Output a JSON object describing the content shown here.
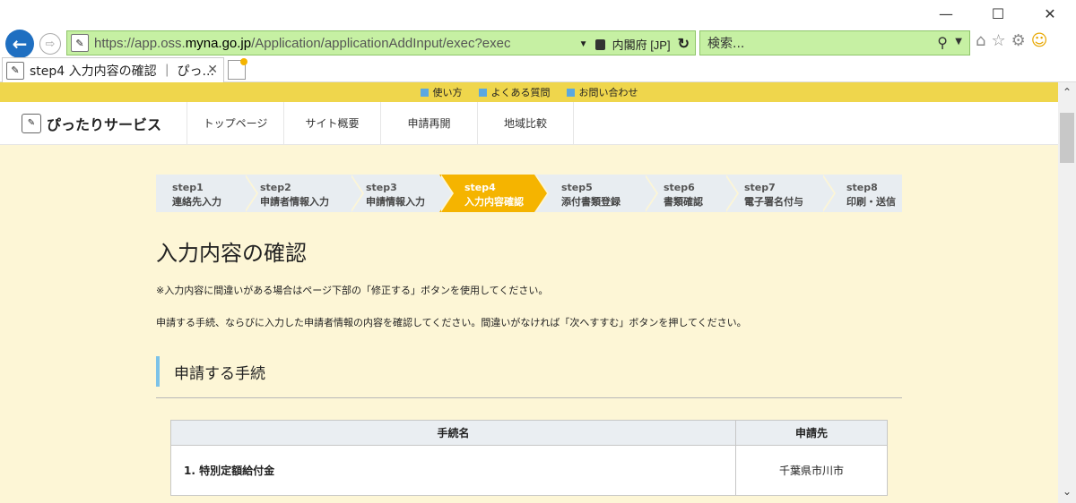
{
  "browser": {
    "url_prefix": "https://app.oss.",
    "url_domain": "myna.go.jp",
    "url_path": "/Application/applicationAddInput/exec?exec",
    "cert_owner": "内閣府 [JP]",
    "search_placeholder": "検索...",
    "tab_title": "step4 入力内容の確認 ｜ ぴっ...",
    "minimize": "—",
    "maximize": "☐",
    "close": "✕"
  },
  "topbar": {
    "links": [
      "使い方",
      "よくある質問",
      "お問い合わせ"
    ]
  },
  "header": {
    "logo": "ぴったりサービス",
    "nav": [
      "トップページ",
      "サイト概要",
      "申請再開",
      "地域比較"
    ]
  },
  "steps": [
    {
      "num": "step1",
      "label": "連絡先入力"
    },
    {
      "num": "step2",
      "label": "申請者情報入力"
    },
    {
      "num": "step3",
      "label": "申請情報入力"
    },
    {
      "num": "step4",
      "label": "入力内容確認"
    },
    {
      "num": "step5",
      "label": "添付書類登録"
    },
    {
      "num": "step6",
      "label": "書類確認"
    },
    {
      "num": "step7",
      "label": "電子署名付与"
    },
    {
      "num": "step8",
      "label": "印刷・送信"
    }
  ],
  "active_step": 4,
  "page": {
    "title": "入力内容の確認",
    "note": "※入力内容に間違いがある場合はページ下部の「修正する」ボタンを使用してください。",
    "desc": "申請する手続、ならびに入力した申請者情報の内容を確認してください。間違いがなければ「次へすすむ」ボタンを押してください。",
    "section_title": "申請する手続"
  },
  "table": {
    "headers": [
      "手続名",
      "申請先"
    ],
    "rows": [
      {
        "name": "1. 特別定額給付金",
        "dest": "千葉県市川市"
      }
    ]
  },
  "colors": {
    "accent_yellow": "#f5b400",
    "topbar": "#efd64c",
    "page_bg": "#fdf6d6",
    "section_bar": "#7cc2e8"
  }
}
